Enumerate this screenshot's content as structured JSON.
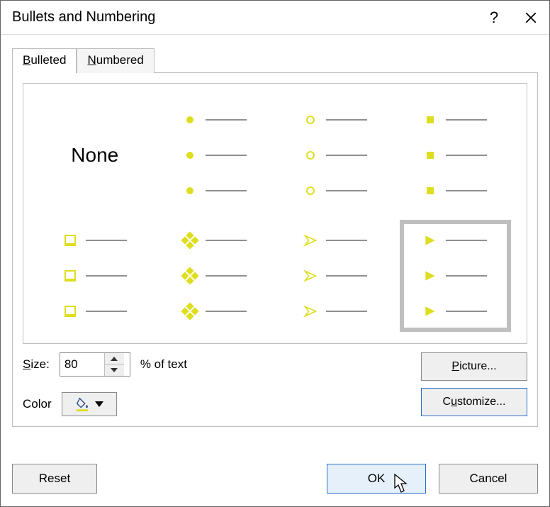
{
  "title": "Bullets and Numbering",
  "titlebar": {
    "help_glyph": "?"
  },
  "tabs": {
    "bulleted": "Bulleted",
    "numbered": "Numbered",
    "active": "bulleted"
  },
  "gallery": {
    "none_label": "None",
    "items": [
      {
        "id": "none",
        "kind": "none",
        "selected": false
      },
      {
        "id": "dot",
        "kind": "dot",
        "selected": false
      },
      {
        "id": "ring",
        "kind": "ring",
        "selected": false
      },
      {
        "id": "square",
        "kind": "square",
        "selected": false
      },
      {
        "id": "box",
        "kind": "box",
        "selected": false
      },
      {
        "id": "diamonds",
        "kind": "diamonds",
        "selected": false
      },
      {
        "id": "arrow",
        "kind": "arrowhead",
        "selected": false
      },
      {
        "id": "triangle",
        "kind": "triangle",
        "selected": true
      }
    ],
    "bullet_color": "#dede20"
  },
  "size": {
    "label": "Size:",
    "value": "80",
    "suffix": "% of text"
  },
  "color": {
    "label": "Color",
    "swatch": "#dede20"
  },
  "buttons": {
    "picture": "Picture...",
    "customize": "Customize...",
    "reset": "Reset",
    "ok": "OK",
    "cancel": "Cancel"
  }
}
